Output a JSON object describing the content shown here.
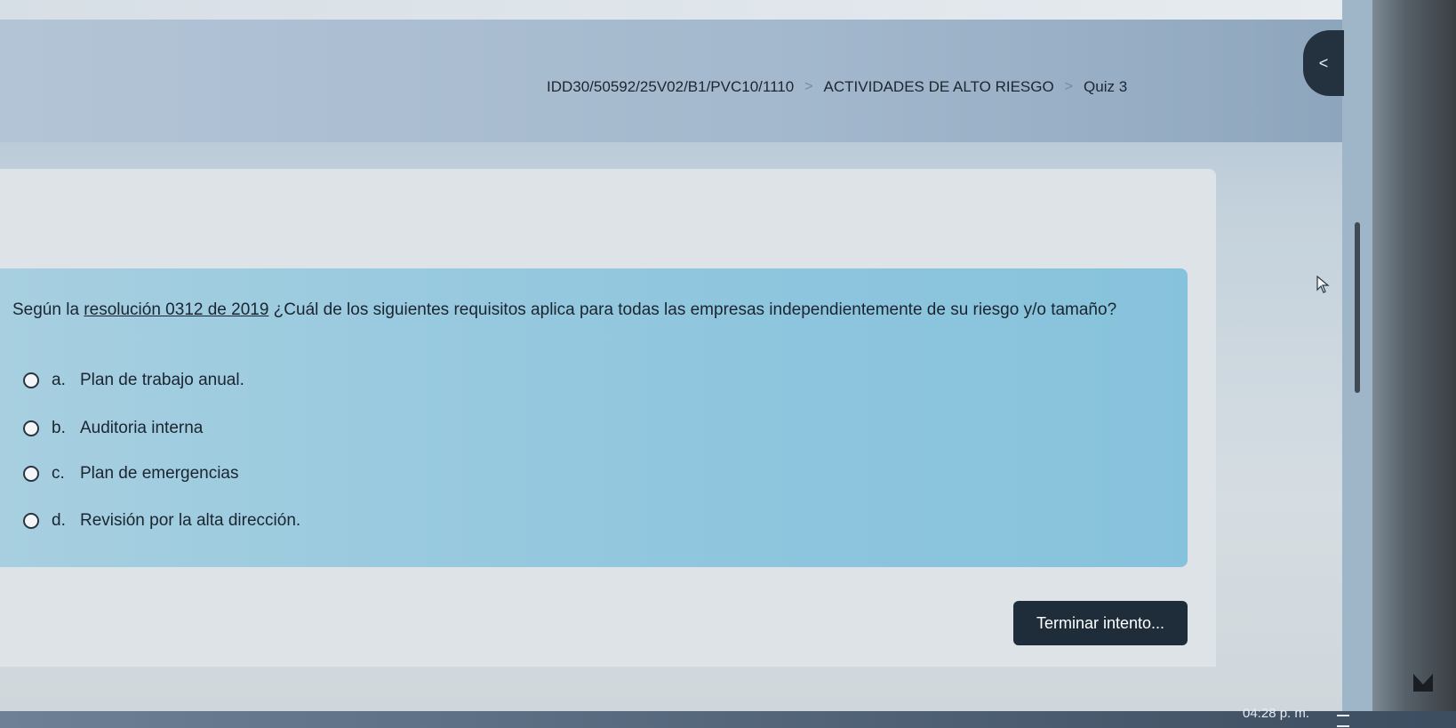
{
  "breadcrumb": {
    "course": "IDD30/50592/25V02/B1/PVC10/1110",
    "section": "ACTIVIDADES DE ALTO RIESGO",
    "current": "Quiz 3",
    "separator": ">"
  },
  "nav": {
    "back_icon": "chevron-left-icon",
    "back_label": "<"
  },
  "question": {
    "prefix": "Según la ",
    "link_text": "resolución 0312 de 2019",
    "text": " ¿Cuál de los siguientes requisitos aplica para todas las empresas independientemente de su riesgo y/o tamaño?",
    "options": [
      {
        "letter": "a.",
        "label": "Plan de trabajo anual."
      },
      {
        "letter": "b.",
        "label": "Auditoria interna"
      },
      {
        "letter": "c.",
        "label": "Plan de emergencias"
      },
      {
        "letter": "d.",
        "label": "Revisión por la alta dirección."
      }
    ]
  },
  "actions": {
    "finish_label": "Terminar intento..."
  },
  "taskbar": {
    "clock": "04:28 p. m."
  },
  "colors": {
    "question_bg": "#8fc6de",
    "button_bg": "#1f2d3b",
    "text": "#1a2530"
  }
}
